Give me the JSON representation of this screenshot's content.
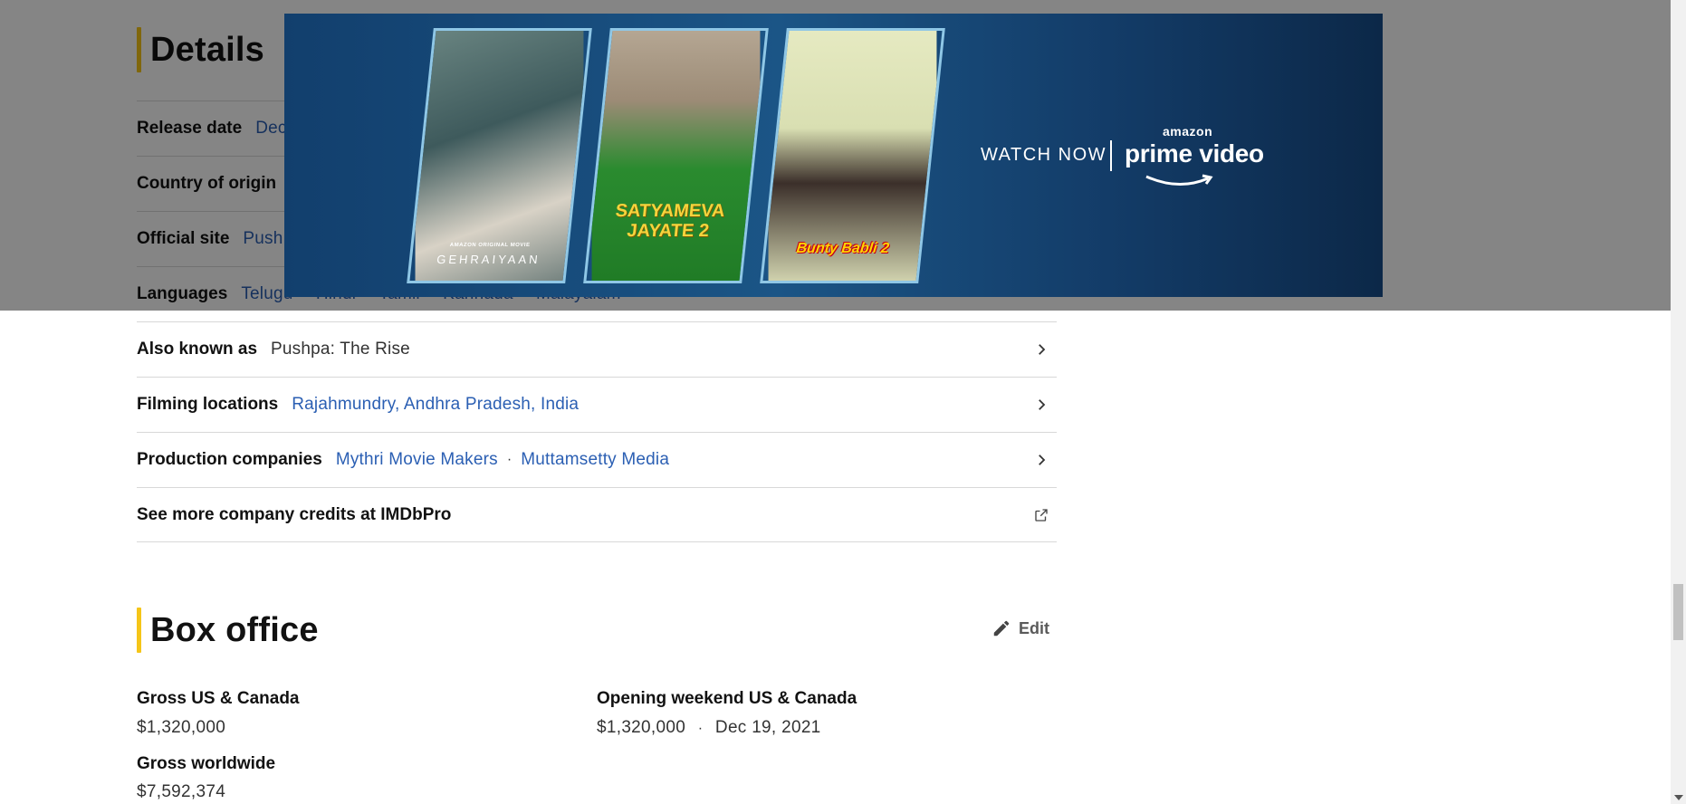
{
  "details": {
    "title": "Details",
    "rows": [
      {
        "label": "Release date",
        "value": "Dec"
      },
      {
        "label": "Country of origin",
        "value": ""
      },
      {
        "label": "Official site",
        "value": "Push"
      },
      {
        "label": "Languages",
        "values": [
          "Telugu",
          "Hindi",
          "Tamil",
          "Kannada",
          "Malayalam"
        ]
      },
      {
        "label": "Also known as",
        "value": "Pushpa: The Rise"
      },
      {
        "label": "Filming locations",
        "value": "Rajahmundry, Andhra Pradesh, India"
      },
      {
        "label": "Production companies",
        "values": [
          "Mythri Movie Makers",
          "Muttamsetty Media"
        ]
      },
      {
        "label": "See more company credits at IMDbPro"
      }
    ]
  },
  "box_office": {
    "title": "Box office",
    "edit_label": "Edit",
    "gross_us_label": "Gross US & Canada",
    "gross_us_value": "$1,320,000",
    "opening_label": "Opening weekend US & Canada",
    "opening_value": "$1,320,000",
    "opening_date": "Dec 19, 2021",
    "gross_world_label": "Gross worldwide",
    "gross_world_value": "$7,592,374"
  },
  "ad": {
    "posters": [
      {
        "title": "GEHRAIYAAN",
        "tag": "AMAZON ORIGINAL MOVIE"
      },
      {
        "title": "SATYAMEVA JAYATE 2"
      },
      {
        "title": "Bunty Babli 2"
      }
    ],
    "cta": "WATCH NOW",
    "brand_small": "amazon",
    "brand": "prime video"
  },
  "colors": {
    "accent": "#f5c518",
    "link": "#2b5fb3",
    "ad_bg": "#1b5586"
  }
}
